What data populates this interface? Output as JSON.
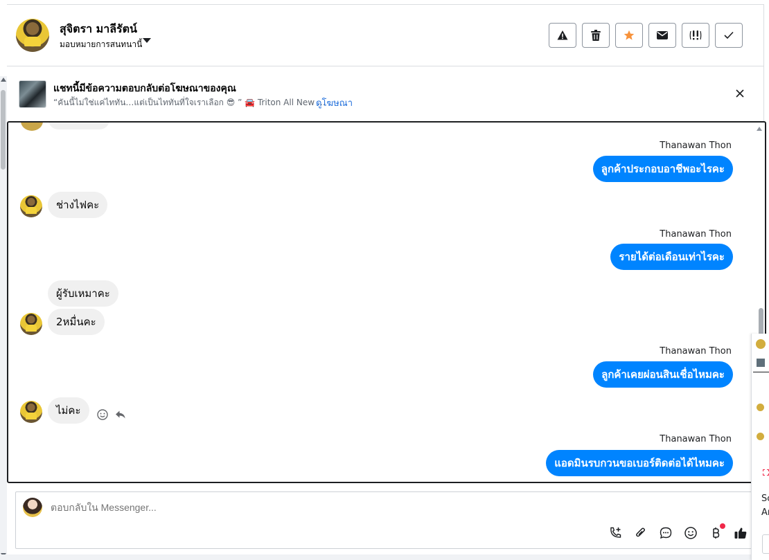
{
  "header": {
    "contact_name": "สุจิตรา มาลีรัตน์",
    "assign_label": "มอบหมายการสนทนานี้",
    "actions": [
      {
        "name": "spam-button",
        "icon": "warning-icon"
      },
      {
        "name": "delete-button",
        "icon": "trash-icon"
      },
      {
        "name": "star-button",
        "icon": "star-icon",
        "color": "#f7923b"
      },
      {
        "name": "mark-unread-button",
        "icon": "envelope-icon"
      },
      {
        "name": "follow-up-button",
        "icon": "follow-up-icon"
      },
      {
        "name": "mark-done-button",
        "icon": "check-icon"
      }
    ]
  },
  "ad_banner": {
    "title": "แชทนี้มีข้อความตอบกลับต่อโฆษณาของคุณ",
    "description": "“คันนี้ไม่ใช่แค่ไททัน…แต่เป็นไททันที่ใจเราเลือก 😎 ” 🚘 Triton All New …",
    "link": "ดูโฆษณา"
  },
  "messages": [
    {
      "direction": "out",
      "sender": "Thanawan Thon",
      "text": "ลูกค้าประกอบอาชีพอะไรคะ"
    },
    {
      "direction": "in",
      "text": "ช่างไฟคะ"
    },
    {
      "direction": "out",
      "sender": "Thanawan Thon",
      "text": "รายได้ต่อเดือนเท่าไรคะ"
    },
    {
      "direction": "in",
      "text": "ผู้รับเหมาคะ"
    },
    {
      "direction": "in",
      "text": "2หมื่นคะ"
    },
    {
      "direction": "out",
      "sender": "Thanawan Thon",
      "text": "ลูกค้าเคยผ่อนสินเชื่อไหมคะ"
    },
    {
      "direction": "in",
      "text": "ไม่คะ"
    },
    {
      "direction": "out",
      "sender": "Thanawan Thon",
      "text": "แอดมินรบกวนขอเบอร์ติดต่อได้ไหมคะ"
    }
  ],
  "composer": {
    "placeholder": "ตอบกลับใน Messenger...",
    "has_notification_dot": true,
    "icons": [
      "add-call-icon",
      "attachment-icon",
      "saved-reply-icon",
      "emoji-icon",
      "payment-icon",
      "thumbs-up-icon"
    ]
  },
  "right_panel": {
    "text_1": "Sc",
    "text_2": "Ar"
  },
  "colors": {
    "outgoing_bubble": "#0084ff",
    "incoming_bubble": "#f0f0f0",
    "link": "#216fdb",
    "notification": "#f02849"
  }
}
